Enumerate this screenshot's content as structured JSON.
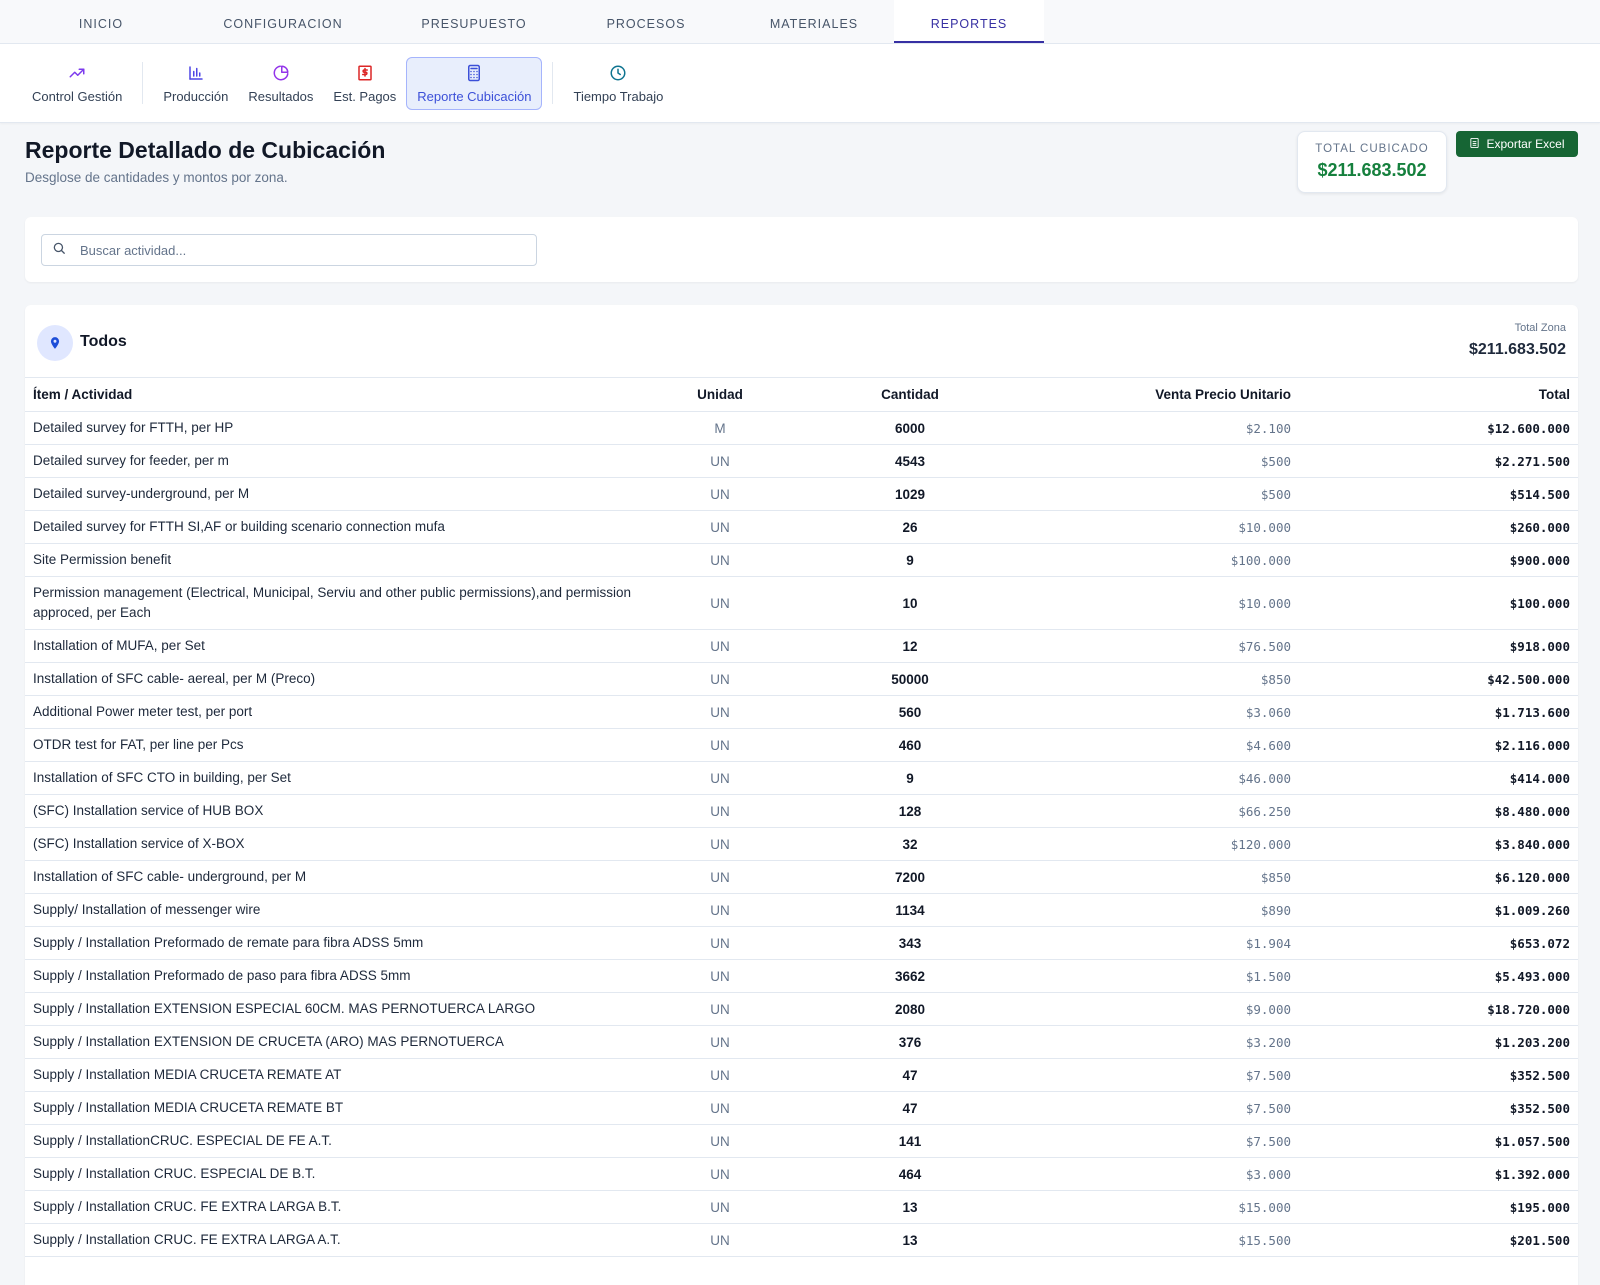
{
  "topnav": {
    "tabs": [
      {
        "label": "INICIO"
      },
      {
        "label": "CONFIGURACION"
      },
      {
        "label": "PRESUPUESTO"
      },
      {
        "label": "PROCESOS"
      },
      {
        "label": "MATERIALES"
      },
      {
        "label": "REPORTES"
      }
    ],
    "active": "REPORTES"
  },
  "subnav": {
    "items": [
      {
        "label": "Control Gestión",
        "icon": "trending-up-icon"
      },
      {
        "label": "Producción",
        "icon": "bar-chart-icon"
      },
      {
        "label": "Resultados",
        "icon": "pie-chart-icon"
      },
      {
        "label": "Est. Pagos",
        "icon": "dollar-doc-icon"
      },
      {
        "label": "Reporte Cubicación",
        "icon": "calculator-icon"
      },
      {
        "label": "Tiempo Trabajo",
        "icon": "clock-icon"
      }
    ],
    "active": "Reporte Cubicación"
  },
  "header": {
    "title": "Reporte Detallado de Cubicación",
    "subtitle": "Desglose de cantidades y montos por zona."
  },
  "summary": {
    "total_label": "TOTAL CUBICADO",
    "total_value": "$211.683.502",
    "export_label": "Exportar Excel"
  },
  "search": {
    "placeholder": "Buscar actividad...",
    "value": ""
  },
  "zone": {
    "name": "Todos",
    "total_label": "Total Zona",
    "total_value": "$211.683.502"
  },
  "table": {
    "headers": {
      "item": "Ítem / Actividad",
      "unit": "Unidad",
      "qty": "Cantidad",
      "price": "Venta Precio Unitario",
      "total": "Total"
    },
    "rows": [
      {
        "item": "Detailed survey for FTTH, per HP",
        "unit": "M",
        "qty": "6000",
        "price": "$2.100",
        "total": "$12.600.000"
      },
      {
        "item": "Detailed survey for feeder, per m",
        "unit": "UN",
        "qty": "4543",
        "price": "$500",
        "total": "$2.271.500"
      },
      {
        "item": "Detailed survey-underground, per M",
        "unit": "UN",
        "qty": "1029",
        "price": "$500",
        "total": "$514.500"
      },
      {
        "item": "Detailed survey for FTTH SI,AF or building scenario connection mufa",
        "unit": "UN",
        "qty": "26",
        "price": "$10.000",
        "total": "$260.000"
      },
      {
        "item": "Site Permission benefit",
        "unit": "UN",
        "qty": "9",
        "price": "$100.000",
        "total": "$900.000"
      },
      {
        "item": "Permission management (Electrical, Municipal, Serviu and other public permissions),and permission approced, per Each",
        "unit": "UN",
        "qty": "10",
        "price": "$10.000",
        "total": "$100.000"
      },
      {
        "item": "Installation of MUFA, per Set",
        "unit": "UN",
        "qty": "12",
        "price": "$76.500",
        "total": "$918.000"
      },
      {
        "item": "Installation of SFC cable- aereal, per M (Preco)",
        "unit": "UN",
        "qty": "50000",
        "price": "$850",
        "total": "$42.500.000"
      },
      {
        "item": "Additional Power meter test, per port",
        "unit": "UN",
        "qty": "560",
        "price": "$3.060",
        "total": "$1.713.600"
      },
      {
        "item": "OTDR test for FAT, per line per Pcs",
        "unit": "UN",
        "qty": "460",
        "price": "$4.600",
        "total": "$2.116.000"
      },
      {
        "item": "Installation of SFC CTO in building, per Set",
        "unit": "UN",
        "qty": "9",
        "price": "$46.000",
        "total": "$414.000"
      },
      {
        "item": "(SFC) Installation service of HUB BOX",
        "unit": "UN",
        "qty": "128",
        "price": "$66.250",
        "total": "$8.480.000"
      },
      {
        "item": "(SFC) Installation service of X-BOX",
        "unit": "UN",
        "qty": "32",
        "price": "$120.000",
        "total": "$3.840.000"
      },
      {
        "item": "Installation of SFC cable- underground, per M",
        "unit": "UN",
        "qty": "7200",
        "price": "$850",
        "total": "$6.120.000"
      },
      {
        "item": "Supply/ Installation of messenger wire",
        "unit": "UN",
        "qty": "1134",
        "price": "$890",
        "total": "$1.009.260"
      },
      {
        "item": "Supply / Installation Preformado de remate para fibra ADSS 5mm",
        "unit": "UN",
        "qty": "343",
        "price": "$1.904",
        "total": "$653.072"
      },
      {
        "item": "Supply / Installation Preformado de paso para fibra ADSS 5mm",
        "unit": "UN",
        "qty": "3662",
        "price": "$1.500",
        "total": "$5.493.000"
      },
      {
        "item": "Supply / Installation EXTENSION ESPECIAL 60CM. MAS PERNOTUERCA LARGO",
        "unit": "UN",
        "qty": "2080",
        "price": "$9.000",
        "total": "$18.720.000"
      },
      {
        "item": "Supply / Installation EXTENSION DE CRUCETA (ARO) MAS PERNOTUERCA",
        "unit": "UN",
        "qty": "376",
        "price": "$3.200",
        "total": "$1.203.200"
      },
      {
        "item": "Supply / Installation MEDIA CRUCETA REMATE AT",
        "unit": "UN",
        "qty": "47",
        "price": "$7.500",
        "total": "$352.500"
      },
      {
        "item": "Supply / Installation MEDIA CRUCETA REMATE BT",
        "unit": "UN",
        "qty": "47",
        "price": "$7.500",
        "total": "$352.500"
      },
      {
        "item": "Supply / InstallationCRUC. ESPECIAL DE FE A.T.",
        "unit": "UN",
        "qty": "141",
        "price": "$7.500",
        "total": "$1.057.500"
      },
      {
        "item": "Supply / Installation CRUC. ESPECIAL DE B.T.",
        "unit": "UN",
        "qty": "464",
        "price": "$3.000",
        "total": "$1.392.000"
      },
      {
        "item": "Supply / Installation CRUC. FE EXTRA LARGA B.T.",
        "unit": "UN",
        "qty": "13",
        "price": "$15.000",
        "total": "$195.000"
      },
      {
        "item": "Supply / Installation CRUC. FE EXTRA LARGA A.T.",
        "unit": "UN",
        "qty": "13",
        "price": "$15.500",
        "total": "$201.500"
      }
    ]
  },
  "colors": {
    "accent": "#3730a3",
    "active_bg": "#e8eefc",
    "success": "#15803d",
    "export_bg": "#166534"
  }
}
